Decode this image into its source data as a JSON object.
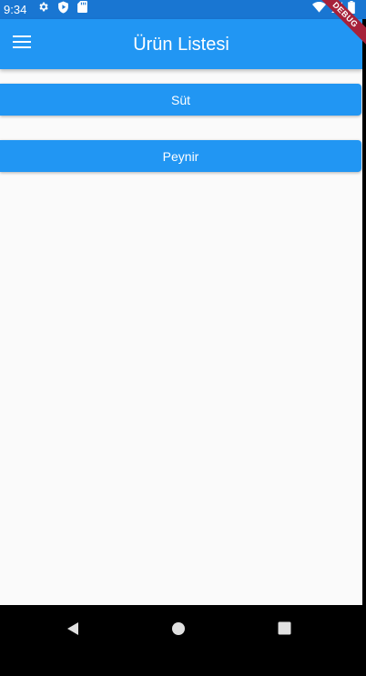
{
  "status_bar": {
    "time": "9:34",
    "bg_color": "#1976D2"
  },
  "app_bar": {
    "title": "Ürün Listesi",
    "bg_color": "#2196F3",
    "menu_icon": "hamburger-menu-icon"
  },
  "products": [
    {
      "label": "Süt"
    },
    {
      "label": "Peynir"
    }
  ],
  "debug_banner": {
    "label": "DEBUG",
    "color": "#A6213A"
  },
  "nav_bar": {
    "back_icon": "back-triangle-icon",
    "home_icon": "home-circle-icon",
    "recents_icon": "recents-square-icon"
  }
}
